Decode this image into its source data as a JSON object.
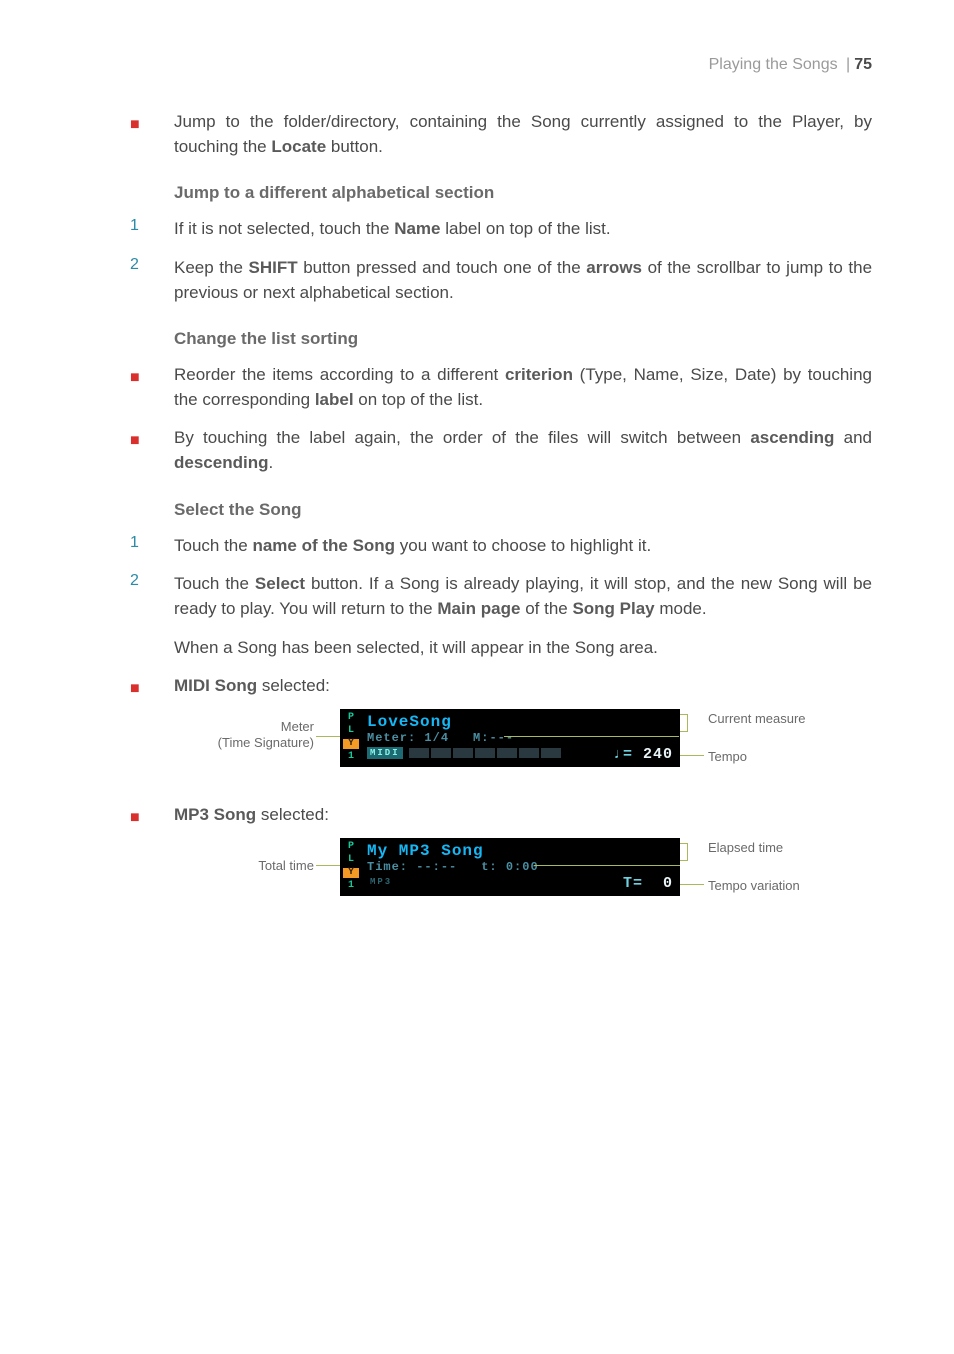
{
  "header": {
    "section": "Playing the Songs",
    "page": "75"
  },
  "para1": {
    "text_before": "Jump to the folder/directory, containing the Song currently assigned to the Player, by touching the ",
    "bold": "Locate",
    "text_after": " button."
  },
  "heading1": "Jump to a different alphabetical section",
  "step1a": {
    "num": "1",
    "pre": "If it is not selected, touch the ",
    "b1": "Name",
    "post": " label on top of the list."
  },
  "step2a": {
    "num": "2",
    "pre": "Keep the ",
    "b1": "SHIFT",
    "mid": " button pressed and touch one of the ",
    "b2": "arrows",
    "post": " of the scrollbar to jump to the previous or next alphabetical section."
  },
  "heading2": "Change the list sorting",
  "bullet1": {
    "pre": "Reorder the items according to a different ",
    "b1": "criterion",
    "mid": " (Type, Name, Size, Date) by touching the corresponding ",
    "b2": "label",
    "post": " on top of the list."
  },
  "bullet2": {
    "pre": "By touching the label again, the order of the files will switch between ",
    "b1": "as­cending",
    "mid": " and ",
    "b2": "descending",
    "post": "."
  },
  "heading3": "Select the Song",
  "step1b": {
    "num": "1",
    "pre": "Touch the ",
    "b1": "name of the Song",
    "post": " you want to choose to highlight it."
  },
  "step2b": {
    "num": "2",
    "pre": "Touch the ",
    "b1": "Select",
    "mid": " button. If a Song is already playing, it will stop, and the new Song will be ready to play. You will return to the ",
    "b2": "Main page",
    "mid2": " of the ",
    "b3": "Song Play",
    "post": " mode."
  },
  "para2": {
    "pre": "When a Song has been selected, it will appear in the ",
    "b1": "Song",
    "post": " area."
  },
  "bullet3": {
    "b1": "MIDI Song",
    "post": " selected:"
  },
  "bullet4": {
    "b1": "MP3 Song",
    "post": " selected:"
  },
  "lcd1": {
    "title": "LoveSong",
    "meter_label": "Meter:",
    "meter_value": "1/4",
    "m_label": "M:",
    "m_value": "---",
    "tag": "MIDI",
    "tempo_prefix": "♩=",
    "tempo_value": "240",
    "side": {
      "p": "P",
      "l": "L",
      "y": "Y",
      "one": "1"
    },
    "callout_left1": "Meter",
    "callout_left2": "(Time Signature)",
    "callout_right1": "Current measure",
    "callout_right2": "Tempo"
  },
  "lcd2": {
    "title": "My MP3 Song",
    "time_label": "Time:",
    "time_value": "--:--",
    "t_label": "t:",
    "t_value": "0:00",
    "tag": "MP3",
    "tvar_prefix": "T=",
    "tvar_value": "0",
    "side": {
      "p": "P",
      "l": "L",
      "y": "Y",
      "one": "1"
    },
    "callout_left1": "Total time",
    "callout_right1": "Elapsed time",
    "callout_right2": "Tempo variation"
  }
}
